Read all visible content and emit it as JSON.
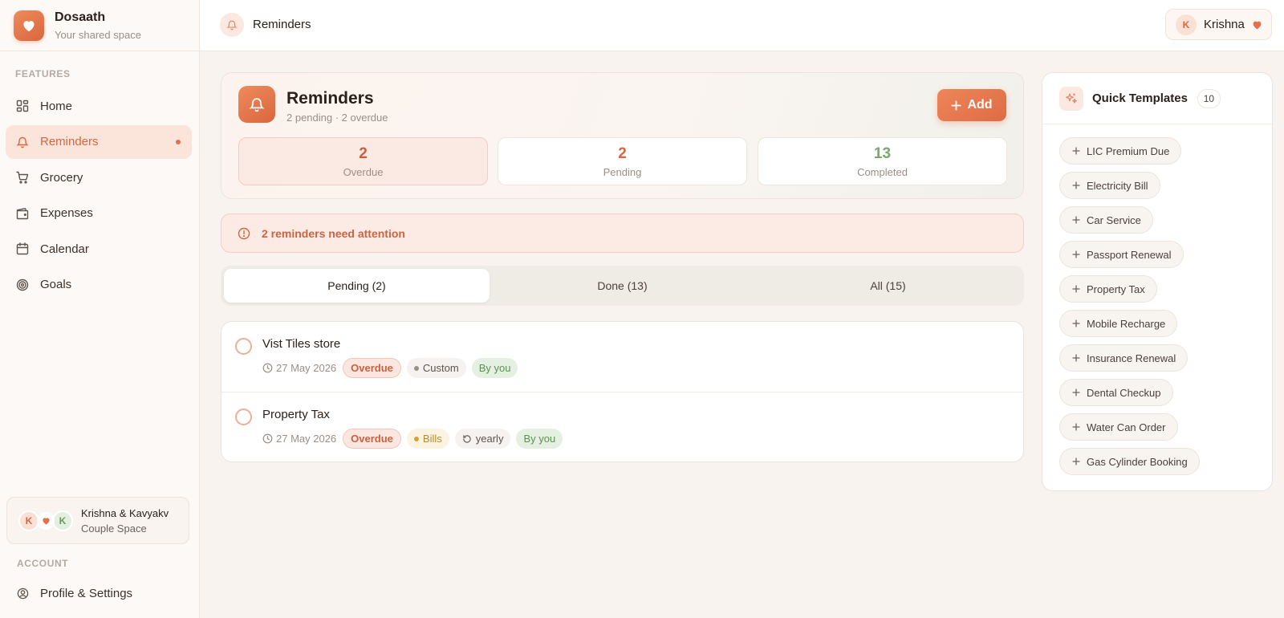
{
  "brand": {
    "name": "Dosaath",
    "tagline": "Your shared space"
  },
  "sidebar": {
    "features_label": "FEATURES",
    "items": [
      {
        "label": "Home",
        "icon": "grid-icon"
      },
      {
        "label": "Reminders",
        "icon": "bell-icon",
        "active": true
      },
      {
        "label": "Grocery",
        "icon": "cart-icon"
      },
      {
        "label": "Expenses",
        "icon": "wallet-icon"
      },
      {
        "label": "Calendar",
        "icon": "calendar-icon"
      },
      {
        "label": "Goals",
        "icon": "target-icon"
      }
    ],
    "couple": {
      "avatar_a": "K",
      "avatar_b": "K",
      "names": "Krishna & Kavyakv",
      "space": "Couple Space"
    },
    "account_label": "ACCOUNT",
    "profile": "Profile & Settings"
  },
  "topbar": {
    "breadcrumb": "Reminders",
    "user_initial": "K",
    "user_name": "Krishna"
  },
  "header": {
    "title": "Reminders",
    "subtitle": "2 pending · 2 overdue",
    "add_label": "Add",
    "stats": {
      "overdue": {
        "value": "2",
        "label": "Overdue"
      },
      "pending": {
        "value": "2",
        "label": "Pending"
      },
      "completed": {
        "value": "13",
        "label": "Completed"
      }
    }
  },
  "alert": {
    "text": "2 reminders need attention"
  },
  "tabs": [
    "Pending (2)",
    "Done (13)",
    "All (15)"
  ],
  "reminders": [
    {
      "title": "Vist Tiles store",
      "date": "27 May 2026",
      "status": "Overdue",
      "category": "Custom",
      "owner": "By you"
    },
    {
      "title": "Property Tax",
      "date": "27 May 2026",
      "status": "Overdue",
      "category": "Bills",
      "repeat": "yearly",
      "owner": "By you"
    }
  ],
  "templates": {
    "title": "Quick Templates",
    "count": "10",
    "items": [
      "LIC Premium Due",
      "Electricity Bill",
      "Car Service",
      "Passport Renewal",
      "Property Tax",
      "Mobile Recharge",
      "Insurance Renewal",
      "Dental Checkup",
      "Water Can Order",
      "Gas Cylinder Booking"
    ]
  },
  "colors": {
    "accent": "#e3704a",
    "overdue": "#c9603f",
    "success": "#7aa76b",
    "bills": "#d4a23a"
  }
}
